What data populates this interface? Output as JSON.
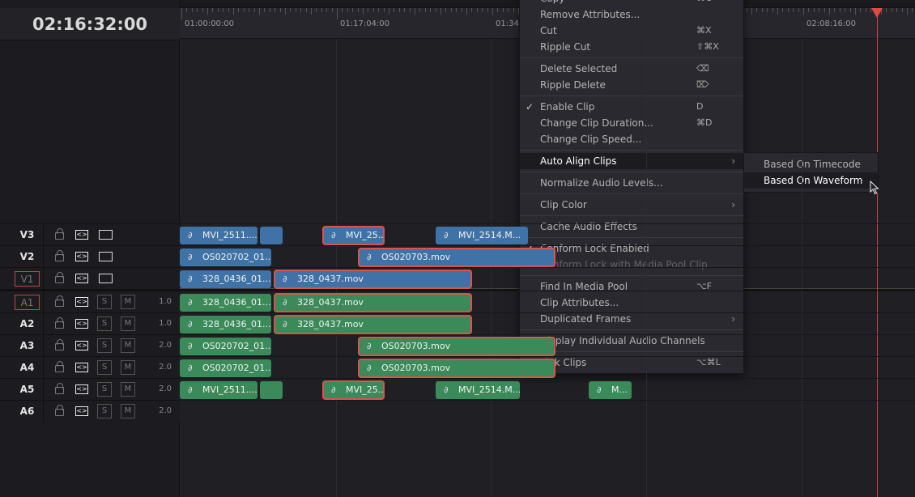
{
  "timecode": "02:16:32:00",
  "ruler": {
    "labels": [
      "01:00:00:00",
      "01:17:04:00",
      "01:34",
      "02:08:16:00"
    ]
  },
  "tracks": [
    {
      "name": "V3",
      "type": "video",
      "targeted": false
    },
    {
      "name": "V2",
      "type": "video",
      "targeted": false
    },
    {
      "name": "V1",
      "type": "video",
      "targeted": true
    },
    {
      "name": "A1",
      "type": "audio",
      "targeted": true,
      "volume": "1.0"
    },
    {
      "name": "A2",
      "type": "audio",
      "targeted": false,
      "volume": "1.0"
    },
    {
      "name": "A3",
      "type": "audio",
      "targeted": false,
      "volume": "2.0"
    },
    {
      "name": "A4",
      "type": "audio",
      "targeted": false,
      "volume": "2.0"
    },
    {
      "name": "A5",
      "type": "audio",
      "targeted": false,
      "volume": "2.0"
    },
    {
      "name": "A6",
      "type": "audio",
      "targeted": false,
      "volume": "2.0"
    }
  ],
  "solo_label": "S",
  "mute_label": "M",
  "auto_label": "<>",
  "clips": [
    {
      "track": 0,
      "name": "MVI_2511....",
      "selected": false
    },
    {
      "track": 0,
      "name": "",
      "selected": false
    },
    {
      "track": 0,
      "name": "MVI_25...",
      "selected": true
    },
    {
      "track": 0,
      "name": "MVI_2514.M...",
      "selected": false
    },
    {
      "track": 1,
      "name": "OS020702_01...",
      "selected": false
    },
    {
      "track": 1,
      "name": "OS020703.mov",
      "selected": true
    },
    {
      "track": 2,
      "name": "328_0436_01....",
      "selected": false
    },
    {
      "track": 2,
      "name": "328_0437.mov",
      "selected": true
    },
    {
      "track": 3,
      "name": "328_0436_01....",
      "selected": false
    },
    {
      "track": 3,
      "name": "328_0437.mov",
      "selected": true
    },
    {
      "track": 4,
      "name": "328_0436_01....",
      "selected": false
    },
    {
      "track": 4,
      "name": "328_0437.mov",
      "selected": true
    },
    {
      "track": 5,
      "name": "OS020702_01...",
      "selected": false
    },
    {
      "track": 5,
      "name": "OS020703.mov",
      "selected": true
    },
    {
      "track": 6,
      "name": "OS020702_01...",
      "selected": false
    },
    {
      "track": 6,
      "name": "OS020703.mov",
      "selected": true
    },
    {
      "track": 7,
      "name": "MVI_2511....",
      "selected": false
    },
    {
      "track": 7,
      "name": "",
      "selected": false
    },
    {
      "track": 7,
      "name": "MVI_25...",
      "selected": true
    },
    {
      "track": 7,
      "name": "MVI_2514.M...",
      "selected": false
    },
    {
      "track": 7,
      "name": "M...",
      "selected": false
    }
  ],
  "colors": {
    "video_clip": "#3f72a6",
    "audio_clip": "#3a8a5a",
    "selection": "#d9534f",
    "playhead": "#d9443c"
  },
  "context_menu": [
    {
      "label": "Copy",
      "shortcut": "⌘C"
    },
    {
      "label": "Remove Attributes..."
    },
    {
      "label": "Cut",
      "shortcut": "⌘X"
    },
    {
      "label": "Ripple Cut",
      "shortcut": "⇧⌘X"
    },
    {
      "sep": true
    },
    {
      "label": "Delete Selected",
      "shortcut": "⌫"
    },
    {
      "label": "Ripple Delete",
      "shortcut": "⌦"
    },
    {
      "sep": true
    },
    {
      "label": "Enable Clip",
      "shortcut": "D",
      "checked": true
    },
    {
      "label": "Change Clip Duration...",
      "shortcut": "⌘D"
    },
    {
      "label": "Change Clip Speed..."
    },
    {
      "sep": true
    },
    {
      "label": "Auto Align Clips",
      "submenu": true,
      "highlighted": true
    },
    {
      "sep": true
    },
    {
      "label": "Normalize Audio Levels..."
    },
    {
      "sep": true
    },
    {
      "label": "Clip Color",
      "submenu": true
    },
    {
      "sep": true
    },
    {
      "label": "Cache Audio Effects"
    },
    {
      "sep": true
    },
    {
      "label": "Conform Lock Enabled",
      "checked": true
    },
    {
      "label": "Conform Lock with Media Pool Clip",
      "disabled": true
    },
    {
      "sep": true
    },
    {
      "label": "Find In Media Pool",
      "shortcut": "⌥F"
    },
    {
      "label": "Clip Attributes..."
    },
    {
      "label": "Duplicated Frames",
      "submenu": true
    },
    {
      "sep": true
    },
    {
      "label": "Display Individual Audio Channels"
    },
    {
      "sep": true
    },
    {
      "label": "Link Clips",
      "shortcut": "⌥⌘L"
    }
  ],
  "submenu": [
    {
      "label": "Based On Timecode"
    },
    {
      "label": "Based On Waveform",
      "highlighted": true
    }
  ]
}
